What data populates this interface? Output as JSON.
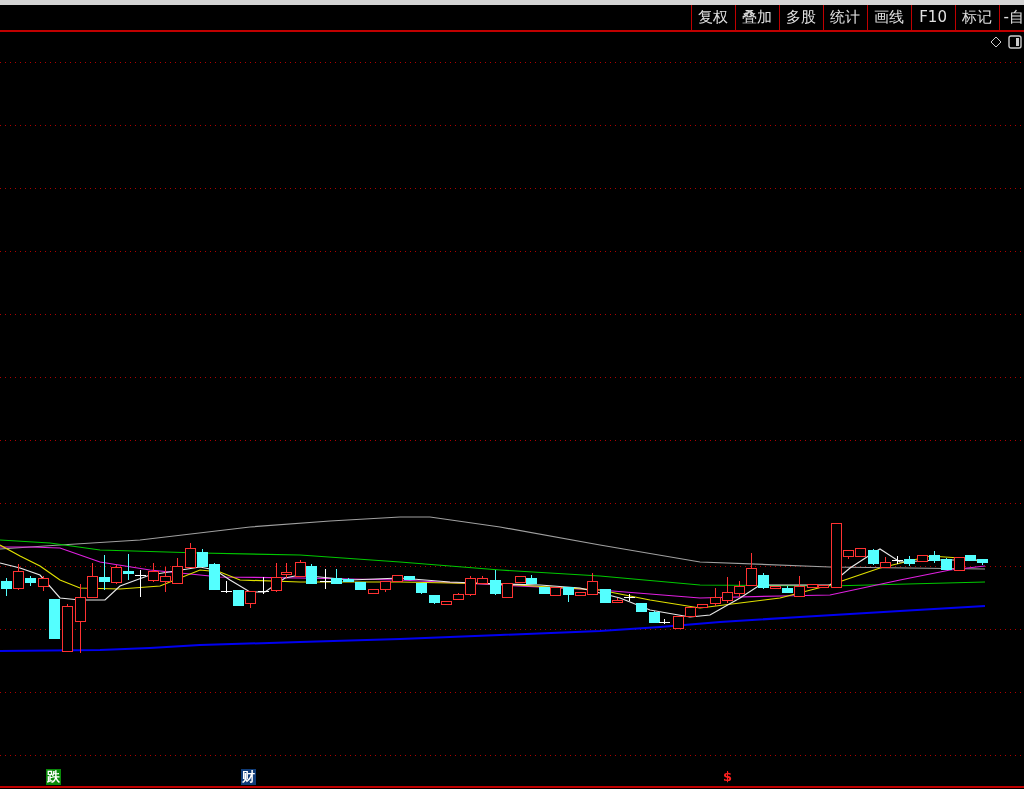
{
  "toolbar": {
    "buttons": [
      "复权",
      "叠加",
      "多股",
      "统计",
      "画线",
      "F10",
      "标记",
      "-自"
    ]
  },
  "event_markers": [
    {
      "label": "跌",
      "kind": "drop"
    },
    {
      "label": "财",
      "kind": "finance"
    },
    {
      "label": "$",
      "kind": "dividend"
    }
  ]
}
